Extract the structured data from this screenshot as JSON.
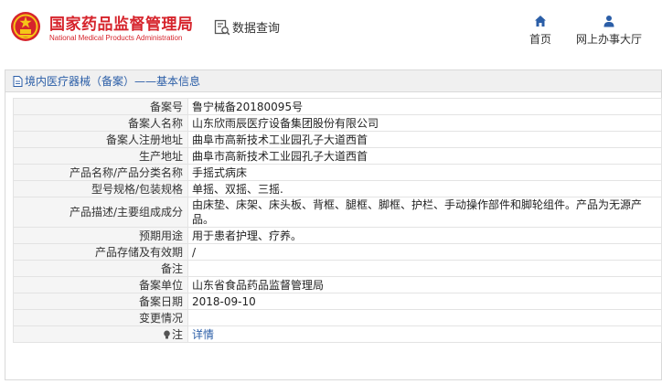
{
  "header": {
    "logo_cn": "国家药品监督管理局",
    "logo_en": "National Medical Products Administration",
    "query_label": "数据查询",
    "query_icon": "search-document-icon",
    "nav": [
      {
        "label": "首页",
        "icon": "home-icon"
      },
      {
        "label": "网上办事大厅",
        "icon": "user-icon"
      }
    ],
    "brand_color": "#d6242c",
    "nav_icon_color": "#2b5ea7"
  },
  "panel": {
    "breadcrumb": "境内医疗器械（备案）——基本信息",
    "link_color": "#2b5ea7"
  },
  "fields": [
    {
      "label": "备案号",
      "value": "鲁宁械备20180095号"
    },
    {
      "label": "备案人名称",
      "value": "山东欣雨辰医疗设备集团股份有限公司"
    },
    {
      "label": "备案人注册地址",
      "value": "曲阜市高新技术工业园孔子大道西首"
    },
    {
      "label": "生产地址",
      "value": "曲阜市高新技术工业园孔子大道西首"
    },
    {
      "label": "产品名称/产品分类名称",
      "value": "手摇式病床"
    },
    {
      "label": "型号规格/包装规格",
      "value": "单摇、双摇、三摇."
    },
    {
      "label": "产品描述/主要组成成分",
      "value": "由床垫、床架、床头板、背框、腿框、脚框、护栏、手动操作部件和脚轮组件。产品为无源产品。"
    },
    {
      "label": "预期用途",
      "value": "用于患者护理、疗养。"
    },
    {
      "label": "产品存储及有效期",
      "value": "/"
    },
    {
      "label": "备注",
      "value": ""
    },
    {
      "label": "备案单位",
      "value": "山东省食品药品监督管理局"
    },
    {
      "label": "备案日期",
      "value": "2018-09-10"
    },
    {
      "label": "变更情况",
      "value": ""
    }
  ],
  "note": {
    "label": "注",
    "icon": "lightbulb-icon",
    "link": "详情"
  }
}
